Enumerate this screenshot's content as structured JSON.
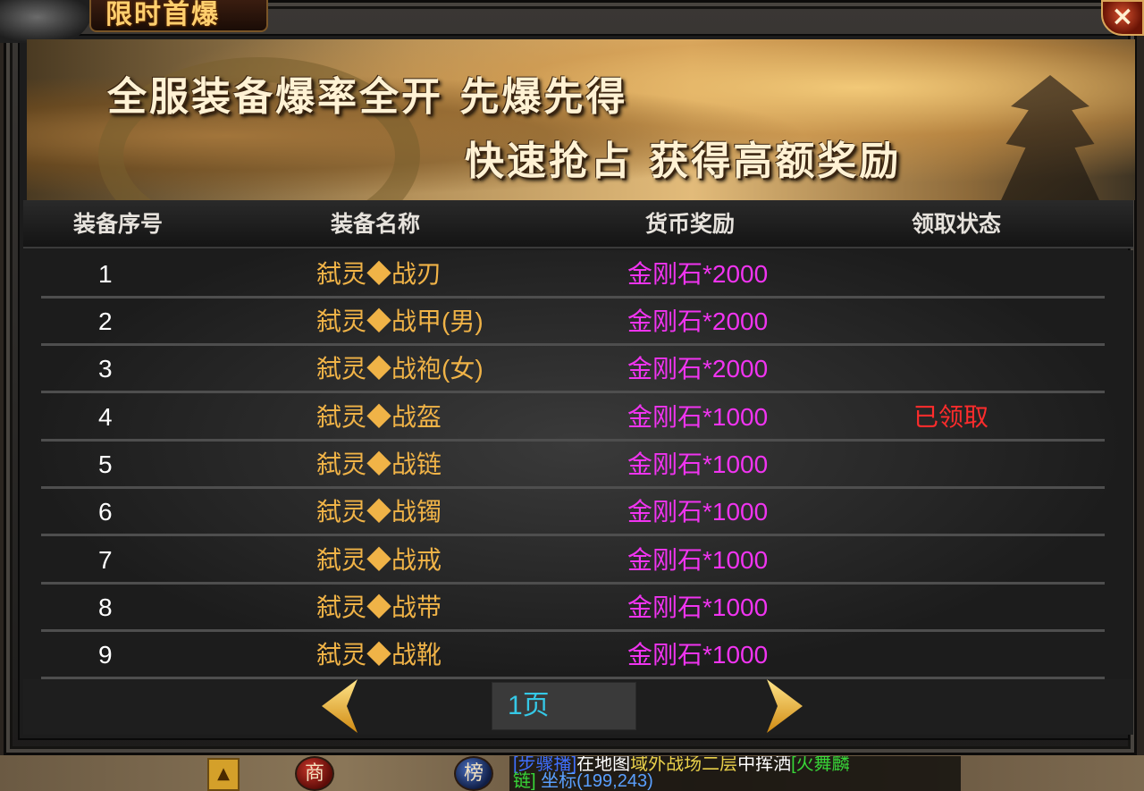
{
  "window": {
    "title": "限时首爆",
    "close_label": "×"
  },
  "banner": {
    "line1": "全服装备爆率全开 先爆先得",
    "line2": "快速抢占 获得高额奖励"
  },
  "table": {
    "headers": [
      "装备序号",
      "装备名称",
      "货币奖励",
      "领取状态"
    ],
    "rows": [
      {
        "index": "1",
        "name": "弑灵◆战刃",
        "reward": "金刚石*2000",
        "status": ""
      },
      {
        "index": "2",
        "name": "弑灵◆战甲(男)",
        "reward": "金刚石*2000",
        "status": ""
      },
      {
        "index": "3",
        "name": "弑灵◆战袍(女)",
        "reward": "金刚石*2000",
        "status": ""
      },
      {
        "index": "4",
        "name": "弑灵◆战盔",
        "reward": "金刚石*1000",
        "status": "已领取"
      },
      {
        "index": "5",
        "name": "弑灵◆战链",
        "reward": "金刚石*1000",
        "status": ""
      },
      {
        "index": "6",
        "name": "弑灵◆战镯",
        "reward": "金刚石*1000",
        "status": ""
      },
      {
        "index": "7",
        "name": "弑灵◆战戒",
        "reward": "金刚石*1000",
        "status": ""
      },
      {
        "index": "8",
        "name": "弑灵◆战带",
        "reward": "金刚石*1000",
        "status": ""
      },
      {
        "index": "9",
        "name": "弑灵◆战靴",
        "reward": "金刚石*1000",
        "status": ""
      }
    ]
  },
  "pager": {
    "page_label": "1页",
    "prev_icon": "arrow-left-icon",
    "next_icon": "arrow-right-icon"
  },
  "hud": {
    "up_arrow": "▲",
    "shop_label": "商",
    "rank_label": "榜",
    "chat_line1_a": "[步骤播]",
    "chat_line1_b": "在地图",
    "chat_line1_c": "域外战场二层",
    "chat_line1_d": "中挥洒",
    "chat_line1_e": "[火舞麟",
    "chat_line2_a": "链]",
    "chat_line2_b": "坐标(199,243)"
  },
  "colors": {
    "item_name": "#f0b347",
    "reward": "#f034f0",
    "claimed": "#ff2c2c",
    "page_text": "#35c8e6",
    "title": "#ffcf6e"
  }
}
